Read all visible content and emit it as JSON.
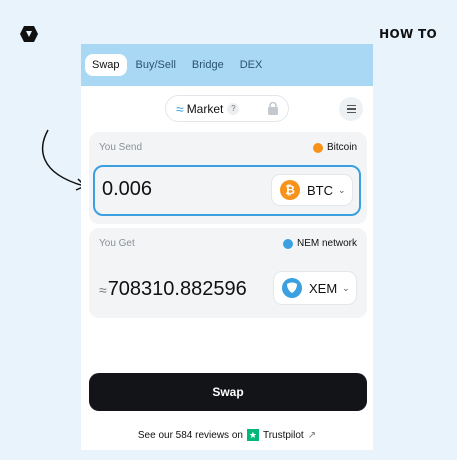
{
  "header": {
    "howto_label": "how to"
  },
  "tabs": [
    {
      "label": "Swap",
      "active": true
    },
    {
      "label": "Buy/Sell",
      "active": false
    },
    {
      "label": "Bridge",
      "active": false
    },
    {
      "label": "DEX",
      "active": false
    }
  ],
  "mode": {
    "label": "Market",
    "help": "?"
  },
  "send": {
    "label": "You Send",
    "network": "Bitcoin",
    "amount": "0.006",
    "coin_code": "BTC",
    "coin_symbol": "₿",
    "coin_color": "#f7931a"
  },
  "receive": {
    "label": "You Get",
    "network": "NEM network",
    "approx": "≈",
    "amount": "708310.882596",
    "coin_code": "XEM",
    "coin_color": "#3aa0e0"
  },
  "swap_button": {
    "label": "Swap"
  },
  "reviews": {
    "text": "See our 584 reviews on",
    "brand": "Trustpilot"
  },
  "icons": {
    "logo": "logo-icon",
    "wave": "wave-icon",
    "lock": "lock-icon",
    "menu": "menu-icon",
    "swap": "swap-arrows-icon",
    "chevron": "chevron-down-icon",
    "external": "external-link-icon",
    "arrow": "hand-drawn-arrow"
  },
  "colors": {
    "accent": "#3aa0e0",
    "tabs_bg": "#a9d8f5",
    "button_bg": "#121418",
    "trustpilot": "#00b67a"
  }
}
